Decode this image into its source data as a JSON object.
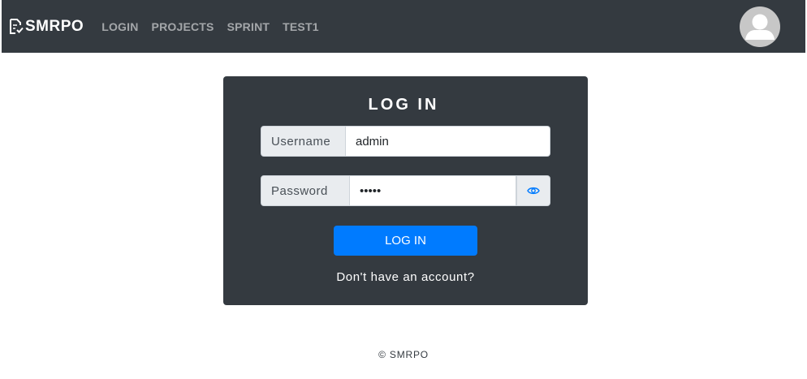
{
  "navbar": {
    "brand": "SMRPO",
    "brand_icon": "file-check-icon",
    "links": [
      {
        "label": "LOGIN"
      },
      {
        "label": "PROJECTS"
      },
      {
        "label": "SPRINT"
      },
      {
        "label": "TEST1"
      }
    ],
    "avatar_icon": "user-avatar-icon"
  },
  "login_form": {
    "title": "LOG IN",
    "username_label": "Username",
    "username_value": "admin",
    "password_label": "Password",
    "password_value": "•••••",
    "toggle_icon": "eye-icon",
    "submit_label": "LOG IN",
    "signup_link": "Don't have an account?"
  },
  "footer": {
    "copyright": "© SMRPO"
  },
  "colors": {
    "navbar_bg": "#343a40",
    "card_bg": "#343a40",
    "primary": "#007bff",
    "addon_bg": "#e9ecef"
  }
}
